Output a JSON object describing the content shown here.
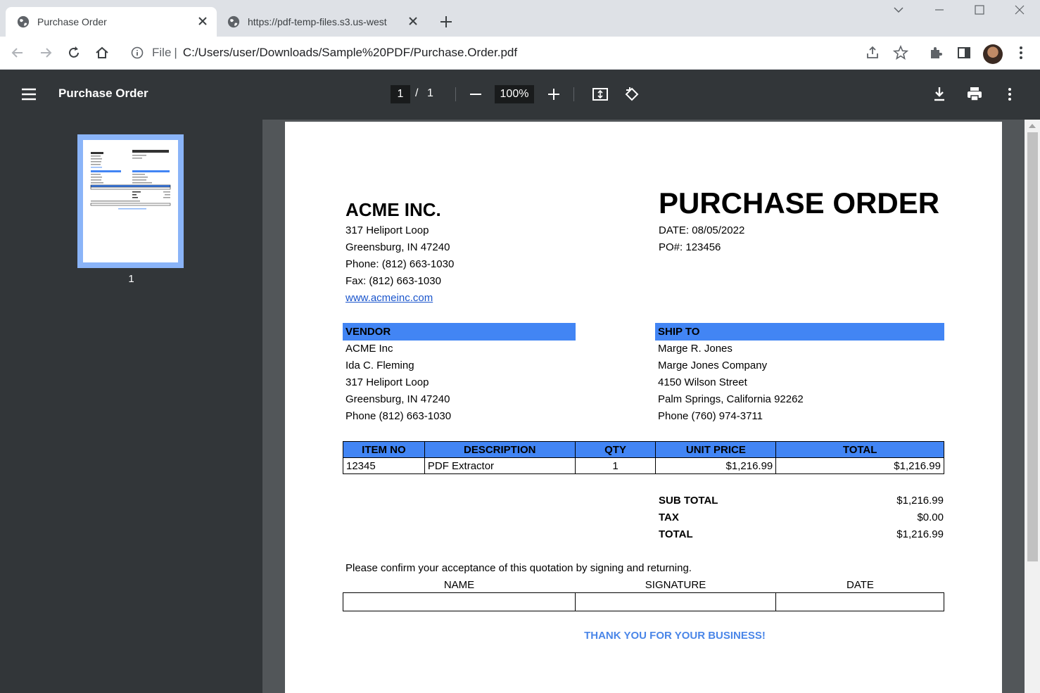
{
  "browser": {
    "tabs": [
      {
        "title": "Purchase Order",
        "active": true
      },
      {
        "title": "https://pdf-temp-files.s3.us-west",
        "active": false
      }
    ],
    "address": {
      "scheme_label": "File",
      "url": "C:/Users/user/Downloads/Sample%20PDF/Purchase.Order.pdf"
    }
  },
  "pdf_viewer": {
    "title": "Purchase Order",
    "current_page": "1",
    "page_separator": "/",
    "total_pages": "1",
    "zoom": "100%",
    "thumbnail_label": "1"
  },
  "document": {
    "company": {
      "name": "ACME INC.",
      "address1": "317 Heliport Loop",
      "address2": "Greensburg, IN 47240",
      "phone": "Phone: (812) 663-1030",
      "fax": "Fax: (812) 663-1030",
      "website": "www.acmeinc.com"
    },
    "title": "PURCHASE ORDER",
    "date": "DATE: 08/05/2022",
    "po": "PO#: 123456",
    "vendor": {
      "header": "VENDOR",
      "lines": [
        "ACME Inc",
        "Ida C. Fleming",
        "317 Heliport Loop",
        "Greensburg, IN 47240",
        "Phone (812) 663-1030"
      ]
    },
    "ship_to": {
      "header": "SHIP TO",
      "lines": [
        "Marge R. Jones",
        "Marge Jones Company",
        "4150 Wilson Street",
        "Palm Springs, California 92262",
        "Phone (760) 974-3711"
      ]
    },
    "items_table": {
      "headers": [
        "ITEM NO",
        "DESCRIPTION",
        "QTY",
        "UNIT PRICE",
        "TOTAL"
      ],
      "rows": [
        [
          "12345",
          "PDF Extractor",
          "1",
          "$1,216.99",
          "$1,216.99"
        ]
      ]
    },
    "totals": [
      {
        "label": "SUB TOTAL",
        "value": "$1,216.99"
      },
      {
        "label": "TAX",
        "value": "$0.00"
      },
      {
        "label": "TOTAL",
        "value": "$1,216.99"
      }
    ],
    "confirm_text": "Please confirm your acceptance of this quotation by signing and returning.",
    "sign_headers": [
      "NAME",
      "SIGNATURE",
      "DATE"
    ],
    "thank_you": "THANK YOU FOR YOUR BUSINESS!"
  },
  "colors": {
    "accent_blue": "#4285f4",
    "viewer_dark": "#323639",
    "doc_background": "#525659",
    "link": "#1a0dab",
    "thank_you": "#4a86e8"
  }
}
